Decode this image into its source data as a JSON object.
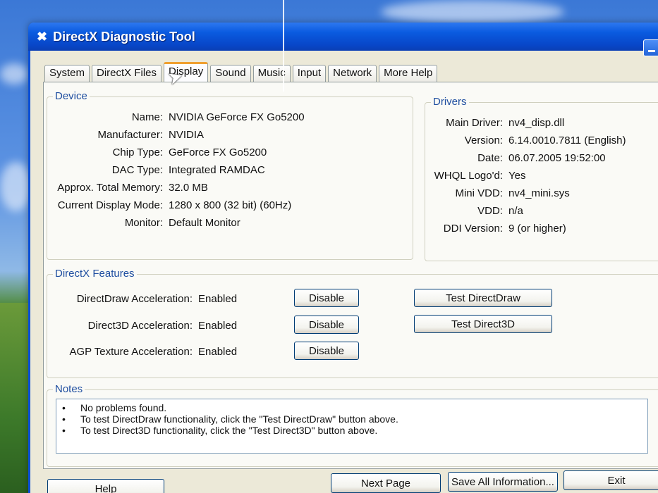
{
  "window": {
    "title": "DirectX Diagnostic Tool"
  },
  "tabs": [
    {
      "label": "System"
    },
    {
      "label": "DirectX Files"
    },
    {
      "label": "Display"
    },
    {
      "label": "Sound"
    },
    {
      "label": "Music"
    },
    {
      "label": "Input"
    },
    {
      "label": "Network"
    },
    {
      "label": "More Help"
    }
  ],
  "active_tab": "Display",
  "device": {
    "label": "Device",
    "fields": [
      {
        "label": "Name:",
        "value": "NVIDIA GeForce FX Go5200"
      },
      {
        "label": "Manufacturer:",
        "value": "NVIDIA"
      },
      {
        "label": "Chip Type:",
        "value": "GeForce FX Go5200"
      },
      {
        "label": "DAC Type:",
        "value": "Integrated RAMDAC"
      },
      {
        "label": "Approx. Total Memory:",
        "value": "32.0 MB"
      },
      {
        "label": "Current Display Mode:",
        "value": "1280 x 800 (32 bit) (60Hz)"
      },
      {
        "label": "Monitor:",
        "value": "Default Monitor"
      }
    ]
  },
  "drivers": {
    "label": "Drivers",
    "fields": [
      {
        "label": "Main Driver:",
        "value": "nv4_disp.dll"
      },
      {
        "label": "Version:",
        "value": "6.14.0010.7811 (English)"
      },
      {
        "label": "Date:",
        "value": "06.07.2005 19:52:00"
      },
      {
        "label": "WHQL Logo'd:",
        "value": "Yes"
      },
      {
        "label": "Mini VDD:",
        "value": "nv4_mini.sys"
      },
      {
        "label": "VDD:",
        "value": "n/a"
      },
      {
        "label": "DDI Version:",
        "value": "9 (or higher)"
      }
    ]
  },
  "features": {
    "label": "DirectX Features",
    "rows": [
      {
        "label": "DirectDraw Acceleration:",
        "value": "Enabled",
        "button": "Disable"
      },
      {
        "label": "Direct3D Acceleration:",
        "value": "Enabled",
        "button": "Disable"
      },
      {
        "label": "AGP Texture Acceleration:",
        "value": "Enabled",
        "button": "Disable"
      }
    ],
    "test_directdraw": "Test DirectDraw",
    "test_direct3d": "Test Direct3D"
  },
  "notes": {
    "label": "Notes",
    "items": [
      "No problems found.",
      "To test DirectDraw functionality, click the \"Test DirectDraw\" button above.",
      "To test Direct3D functionality, click the \"Test Direct3D\" button above."
    ]
  },
  "footer": {
    "help": "Help",
    "next_page": "Next Page",
    "save_all": "Save All Information...",
    "exit": "Exit"
  }
}
